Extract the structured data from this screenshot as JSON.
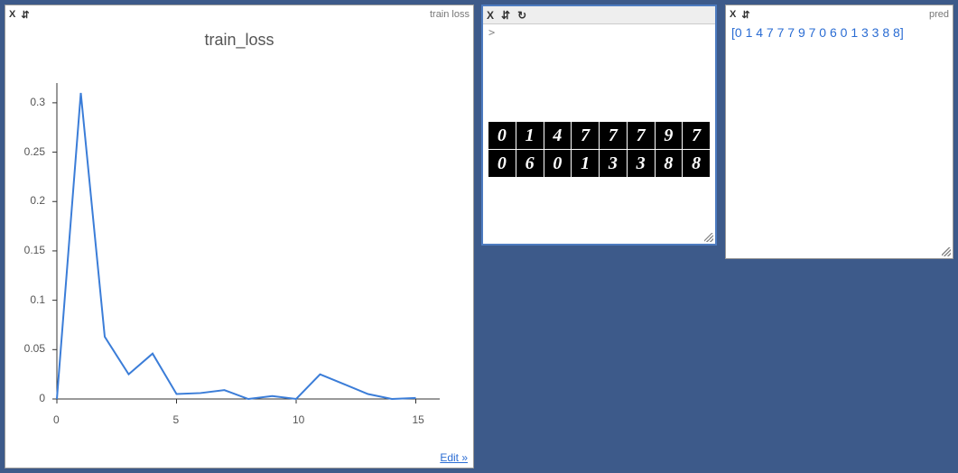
{
  "chart_data": {
    "type": "line",
    "title": "train_loss",
    "xlabel": "",
    "ylabel": "",
    "xlim": [
      0,
      16
    ],
    "ylim": [
      0,
      0.32
    ],
    "x": [
      0,
      1,
      2,
      3,
      4,
      5,
      6,
      7,
      8,
      9,
      10,
      11,
      12,
      13,
      14,
      15
    ],
    "values": [
      0,
      0.31,
      0.063,
      0.025,
      0.046,
      0.005,
      0.006,
      0.009,
      0.0,
      0.003,
      0.0,
      0.025,
      0.015,
      0.005,
      0.0,
      0.001
    ],
    "y_ticks": [
      0,
      0.05,
      0.1,
      0.15,
      0.2,
      0.25,
      0.3
    ],
    "x_ticks": [
      0,
      5,
      10,
      15
    ]
  },
  "panes": {
    "chart": {
      "close_label": "X",
      "drag_label": "⇵",
      "title": "train_loss",
      "name_header": "train loss",
      "edit_label": "Edit »"
    },
    "images": {
      "close_label": "X",
      "drag_label": "⇵",
      "reload_label": "↻",
      "prompt": ">",
      "digits_row1": [
        "0",
        "1",
        "4",
        "7",
        "7",
        "7",
        "9",
        "7"
      ],
      "digits_row2": [
        "0",
        "6",
        "0",
        "1",
        "3",
        "3",
        "8",
        "8"
      ]
    },
    "pred": {
      "close_label": "X",
      "drag_label": "⇵",
      "name_header": "pred",
      "text": "[0 1 4 7 7 7 9 7 0 6 0 1 3 3 8 8]"
    }
  }
}
